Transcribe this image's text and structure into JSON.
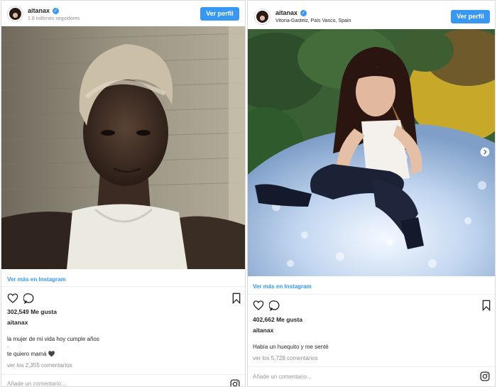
{
  "posts": [
    {
      "username": "aitanax",
      "subline": "1.8 millones seguidores",
      "ver_perfil": "Ver perfil",
      "ver_mas": "Ver más en Instagram",
      "likes": "302,549 Me gusta",
      "owner": "aitanax",
      "caption_line1": "la mujer de mi vida hoy cumple años",
      "caption_dot": ".",
      "caption_line2": "te quiero mamá",
      "heart_emoji": "🖤",
      "view_comments": "ver los 2,355 comentarios",
      "add_comment": "Añade un comentario..."
    },
    {
      "username": "aitanax",
      "subline": "Vitoria-Gasteiz, País Vasco, Spain",
      "ver_perfil": "Ver perfil",
      "ver_mas": "Ver más en Instagram",
      "likes": "402,662 Me gusta",
      "owner": "aitanax",
      "caption_line1": "Había un huequito y me senté",
      "view_comments": "ver los 5,728 comentarios",
      "add_comment": "Añade un comentario..."
    }
  ],
  "colors": {
    "accent": "#3897f0",
    "muted": "#8e8e8e",
    "text": "#262626",
    "border": "#dbdbdb"
  },
  "icons": [
    "verified-badge-icon",
    "heart-icon",
    "comment-icon",
    "bookmark-icon",
    "instagram-icon",
    "chevron-right-icon"
  ]
}
